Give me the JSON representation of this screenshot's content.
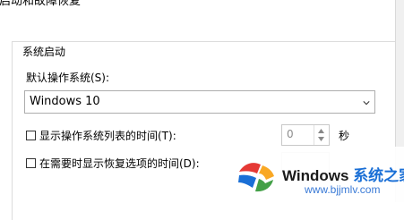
{
  "window": {
    "title": "启动和故障恢复"
  },
  "group": {
    "legend": "系统启动",
    "default_os_label": "默认操作系统(S):",
    "default_os_value": "Windows 10",
    "show_list": {
      "label": "显示操作系统列表的时间(T):",
      "checked": false,
      "value": "0"
    },
    "show_recovery": {
      "label": "在需要时显示恢复选项的时间(D):",
      "checked": false,
      "value": ""
    },
    "unit": "秒"
  },
  "watermark": {
    "brand": "Windows",
    "brand_cn": "系统之家",
    "url": "www.bjjmlv.com",
    "colors": {
      "blue": "#1a6fd6",
      "red": "#e53935",
      "yellow": "#f9a825",
      "green": "#43a047"
    }
  }
}
